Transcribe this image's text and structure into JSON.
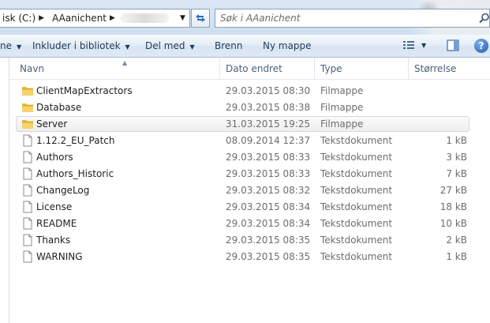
{
  "address": {
    "crumbs": [
      "isk (C:)",
      "AAanichent"
    ],
    "search_placeholder": "Søk i AAanichent"
  },
  "toolbar": {
    "organize_label": "ne",
    "include_label": "Inkluder i bibliotek",
    "share_label": "Del med",
    "burn_label": "Brenn",
    "new_folder_label": "Ny mappe",
    "help_label": "?"
  },
  "columns": {
    "name": "Navn",
    "date": "Dato endret",
    "type": "Type",
    "size": "Størrelse"
  },
  "files": [
    {
      "name": "ClientMapExtractors",
      "date": "29.03.2015 08:30",
      "type": "Filmappe",
      "size": "",
      "kind": "folder",
      "selected": false
    },
    {
      "name": "Database",
      "date": "29.03.2015 08:38",
      "type": "Filmappe",
      "size": "",
      "kind": "folder",
      "selected": false
    },
    {
      "name": "Server",
      "date": "31.03.2015 19:25",
      "type": "Filmappe",
      "size": "",
      "kind": "folder",
      "selected": true
    },
    {
      "name": "1.12.2_EU_Patch",
      "date": "08.09.2014 12:37",
      "type": "Tekstdokument",
      "size": "1 kB",
      "kind": "text",
      "selected": false
    },
    {
      "name": "Authors",
      "date": "29.03.2015 08:33",
      "type": "Tekstdokument",
      "size": "3 kB",
      "kind": "text",
      "selected": false
    },
    {
      "name": "Authors_Historic",
      "date": "29.03.2015 08:33",
      "type": "Tekstdokument",
      "size": "7 kB",
      "kind": "text",
      "selected": false
    },
    {
      "name": "ChangeLog",
      "date": "29.03.2015 08:32",
      "type": "Tekstdokument",
      "size": "27 kB",
      "kind": "text",
      "selected": false
    },
    {
      "name": "License",
      "date": "29.03.2015 08:34",
      "type": "Tekstdokument",
      "size": "18 kB",
      "kind": "text",
      "selected": false
    },
    {
      "name": "README",
      "date": "29.03.2015 08:34",
      "type": "Tekstdokument",
      "size": "10 kB",
      "kind": "text",
      "selected": false
    },
    {
      "name": "Thanks",
      "date": "29.03.2015 08:35",
      "type": "Tekstdokument",
      "size": "2 kB",
      "kind": "text",
      "selected": false
    },
    {
      "name": "WARNING",
      "date": "29.03.2015 08:35",
      "type": "Tekstdokument",
      "size": "1 kB",
      "kind": "text",
      "selected": false
    }
  ],
  "colors": {
    "folder": "#e8b83c",
    "accent": "#1d5aa8",
    "header_text": "#4c607a"
  }
}
